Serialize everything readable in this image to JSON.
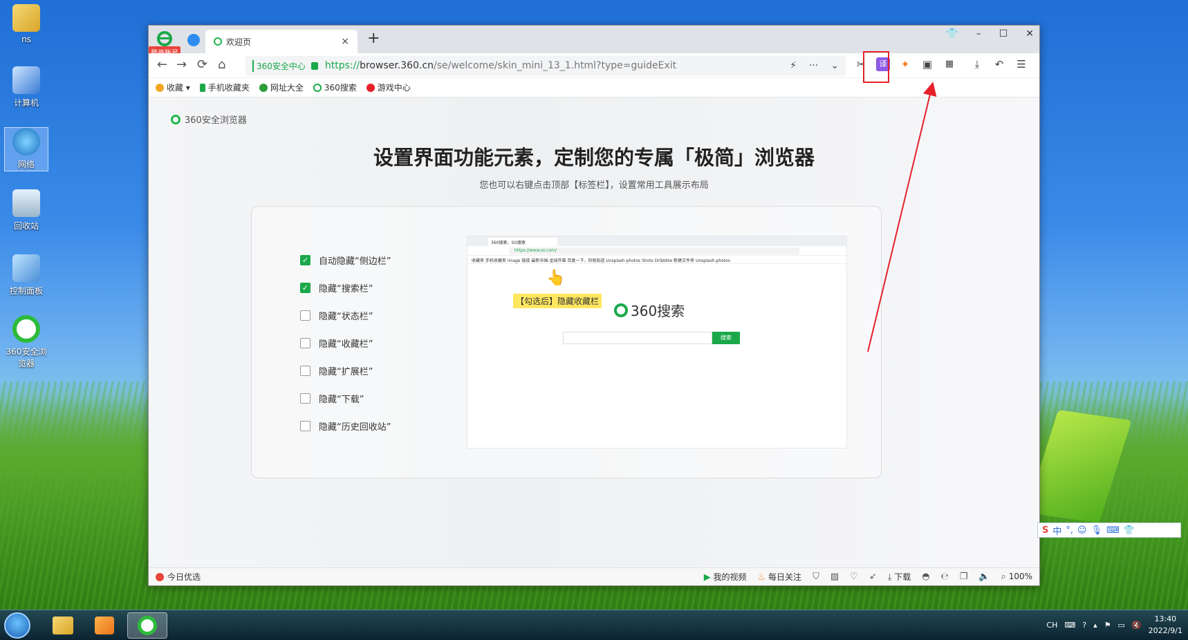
{
  "desktop": {
    "icons": [
      {
        "label": "ns"
      },
      {
        "label": "计算机"
      },
      {
        "label": "网络"
      },
      {
        "label": "回收站"
      },
      {
        "label": "控制面板"
      },
      {
        "label": "360安全浏览器"
      }
    ]
  },
  "browser": {
    "login_badge": "登录账号",
    "tab_title": "欢迎页",
    "tab_close": "×",
    "new_tab": "+",
    "window_controls": {
      "skin": "👕",
      "minimize": "–",
      "maximize": "☐",
      "close": "✕"
    },
    "security_center": "360安全中心",
    "url_scheme": "https://",
    "url_host": "browser.360.cn",
    "url_path": "/se/welcome/skin_mini_13_1.html?type=guideExit",
    "bookmarks": [
      {
        "label": "收藏",
        "color": "#f5a623"
      },
      {
        "label": "手机收藏夹",
        "color": "#1aa84a"
      },
      {
        "label": "网址大全",
        "color": "#2a9d3a"
      },
      {
        "label": "360搜索",
        "color": "#1aa84a"
      },
      {
        "label": "游戏中心",
        "color": "#e5212a"
      }
    ],
    "content": {
      "brand": "360安全浏览器",
      "headline": "设置界面功能元素，定制您的专属「极简」浏览器",
      "subline": "您也可以右键点击顶部【标签栏】，设置常用工具展示布局",
      "options": [
        {
          "label": "自动隐藏“侧边栏”",
          "checked": true
        },
        {
          "label": "隐藏“搜索栏”",
          "checked": true
        },
        {
          "label": "隐藏“状态栏”",
          "checked": false
        },
        {
          "label": "隐藏“收藏栏”",
          "checked": false
        },
        {
          "label": "隐藏“扩展栏”",
          "checked": false
        },
        {
          "label": "隐藏“下载”",
          "checked": false
        },
        {
          "label": "隐藏“历史回收站”",
          "checked": false
        }
      ],
      "preview": {
        "tab_title": "360搜索，SO搜索",
        "url": "https://www.so.com/",
        "bookmarks": "收藏夹  手机收藏夹  image  链接  最新中国-金球开幕  百度一下，你就知道  Unsplash photos  Shots Dribbble  新建文件夹  Unsplash-photos",
        "hint": "【勾选后】隐藏收藏栏",
        "logo": "360搜索",
        "search_button": "搜索"
      }
    },
    "status_bar": {
      "today": "今日优选",
      "my_video": "我的视频",
      "daily_follow": "每日关注",
      "download": "下载",
      "zoom": "100%"
    },
    "accent": "#1aa84a",
    "highlight_color": "#e5212a"
  },
  "ime": {
    "label": "中"
  },
  "taskbar": {
    "lang": "CH",
    "time": "13:40",
    "date": "2022/9/1"
  }
}
